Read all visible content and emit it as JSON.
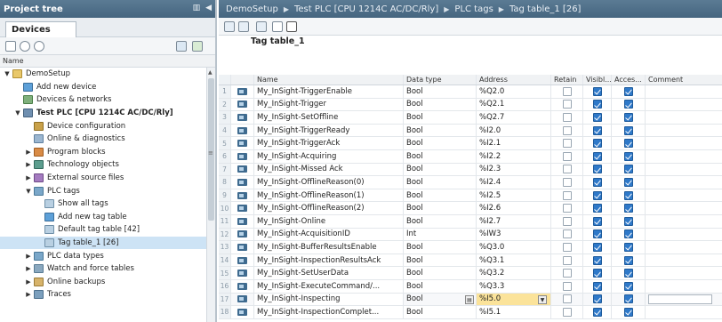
{
  "project_tree": {
    "title": "Project tree",
    "devices_tab": "Devices",
    "name_column": "Name",
    "items": [
      {
        "label": "DemoSetup",
        "level": 0,
        "arrow": "▼",
        "icon": "folder"
      },
      {
        "label": "Add new device",
        "level": 1,
        "arrow": "",
        "icon": "device"
      },
      {
        "label": "Devices & networks",
        "level": 1,
        "arrow": "",
        "icon": "net"
      },
      {
        "label": "Test PLC [CPU 1214C AC/DC/Rly]",
        "level": 1,
        "arrow": "▼",
        "icon": "plc",
        "bold": true
      },
      {
        "label": "Device configuration",
        "level": 2,
        "arrow": "",
        "icon": "cfg"
      },
      {
        "label": "Online & diagnostics",
        "level": 2,
        "arrow": "",
        "icon": "diag"
      },
      {
        "label": "Program blocks",
        "level": 2,
        "arrow": "▶",
        "icon": "block"
      },
      {
        "label": "Technology objects",
        "level": 2,
        "arrow": "▶",
        "icon": "tech"
      },
      {
        "label": "External source files",
        "level": 2,
        "arrow": "▶",
        "icon": "ext"
      },
      {
        "label": "PLC tags",
        "level": 2,
        "arrow": "▼",
        "icon": "tags"
      },
      {
        "label": "Show all tags",
        "level": 3,
        "arrow": "",
        "icon": "tagt"
      },
      {
        "label": "Add new tag table",
        "level": 3,
        "arrow": "",
        "icon": "device"
      },
      {
        "label": "Default tag table [42]",
        "level": 3,
        "arrow": "",
        "icon": "tagt"
      },
      {
        "label": "Tag table_1 [26]",
        "level": 3,
        "arrow": "",
        "icon": "tagt",
        "selected": true
      },
      {
        "label": "PLC data types",
        "level": 2,
        "arrow": "▶",
        "icon": "tags"
      },
      {
        "label": "Watch and force tables",
        "level": 2,
        "arrow": "▶",
        "icon": "watch"
      },
      {
        "label": "Online backups",
        "level": 2,
        "arrow": "▶",
        "icon": "backup"
      },
      {
        "label": "Traces",
        "level": 2,
        "arrow": "▶",
        "icon": "trace"
      }
    ]
  },
  "breadcrumb": [
    "DemoSetup",
    "Test PLC [CPU 1214C AC/DC/Rly]",
    "PLC tags",
    "Tag table_1 [26]"
  ],
  "tag_table": {
    "title": "Tag table_1",
    "columns": [
      "Name",
      "Data type",
      "Address",
      "Retain",
      "Visibl...",
      "Acces...",
      "Comment"
    ],
    "rows": [
      {
        "num": "1",
        "name": "My_InSight-TriggerEnable",
        "type": "Bool",
        "address": "%Q2.0"
      },
      {
        "num": "2",
        "name": "My_InSight-Trigger",
        "type": "Bool",
        "address": "%Q2.1"
      },
      {
        "num": "3",
        "name": "My_InSight-SetOffline",
        "type": "Bool",
        "address": "%Q2.7"
      },
      {
        "num": "4",
        "name": "My_InSight-TriggerReady",
        "type": "Bool",
        "address": "%I2.0"
      },
      {
        "num": "5",
        "name": "My_InSight-TriggerAck",
        "type": "Bool",
        "address": "%I2.1"
      },
      {
        "num": "6",
        "name": "My_InSight-Acquiring",
        "type": "Bool",
        "address": "%I2.2"
      },
      {
        "num": "7",
        "name": "My_InSight-Missed Ack",
        "type": "Bool",
        "address": "%I2.3"
      },
      {
        "num": "8",
        "name": "My_InSight-OfflineReason(0)",
        "type": "Bool",
        "address": "%I2.4"
      },
      {
        "num": "9",
        "name": "My_InSight-OfflineReason(1)",
        "type": "Bool",
        "address": "%I2.5"
      },
      {
        "num": "10",
        "name": "My_InSight-OfflineReason(2)",
        "type": "Bool",
        "address": "%I2.6"
      },
      {
        "num": "11",
        "name": "My_InSight-Online",
        "type": "Bool",
        "address": "%I2.7"
      },
      {
        "num": "12",
        "name": "My_InSight-AcquisitionID",
        "type": "Int",
        "address": "%IW3"
      },
      {
        "num": "13",
        "name": "My_InSight-BufferResultsEnable",
        "type": "Bool",
        "address": "%Q3.0"
      },
      {
        "num": "14",
        "name": "My_InSight-InspectionResultsAck",
        "type": "Bool",
        "address": "%Q3.1"
      },
      {
        "num": "15",
        "name": "My_InSight-SetUserData",
        "type": "Bool",
        "address": "%Q3.2"
      },
      {
        "num": "16",
        "name": "My_InSight-ExecuteCommand/...",
        "type": "Bool",
        "address": "%Q3.3"
      },
      {
        "num": "17",
        "name": "My_InSight-Inspecting",
        "type": "Bool",
        "address": "%I5.0",
        "editing": true
      },
      {
        "num": "18",
        "name": "My_InSight-InspectionComplet...",
        "type": "Bool",
        "address": "%I5.1"
      }
    ]
  }
}
